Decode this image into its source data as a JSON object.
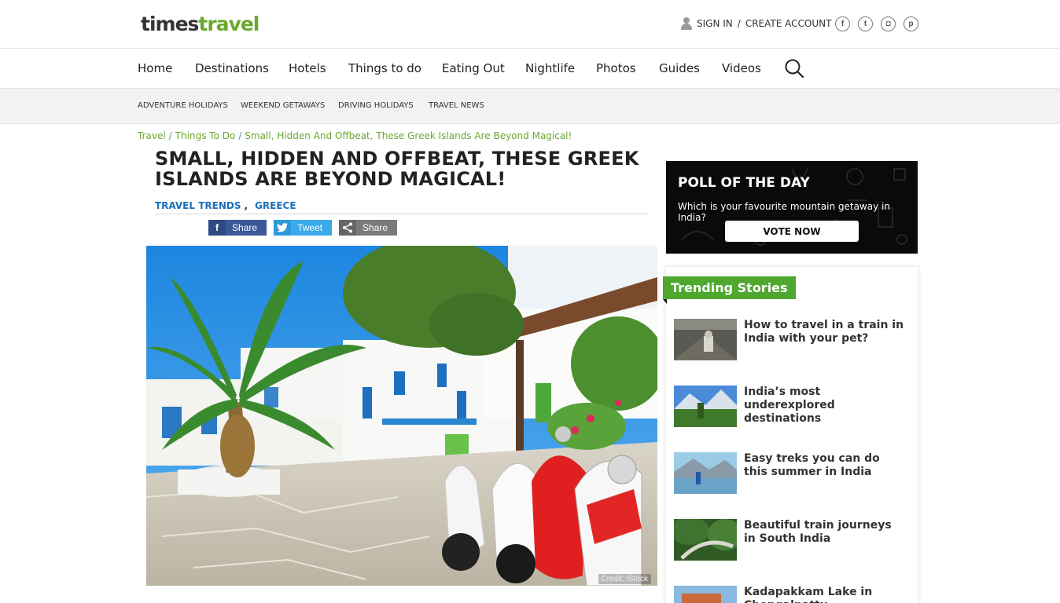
{
  "header": {
    "logo_part1": "times",
    "logo_part2": "travel",
    "sign_in": "SIGN IN",
    "separator": "/",
    "create_account": "CREATE ACCOUNT",
    "socials": [
      {
        "icon": "facebook-icon",
        "glyph": "f"
      },
      {
        "icon": "twitter-icon",
        "glyph": "t"
      },
      {
        "icon": "instagram-icon",
        "glyph": "◘"
      },
      {
        "icon": "pinterest-icon",
        "glyph": "p"
      }
    ]
  },
  "main_nav": [
    "Home",
    "Destinations",
    "Hotels",
    "Things to do",
    "Eating Out",
    "Nightlife",
    "Photos",
    "Guides",
    "Videos"
  ],
  "sub_nav": [
    "ADVENTURE HOLIDAYS",
    "WEEKEND GETAWAYS",
    "DRIVING HOLIDAYS",
    "TRAVEL NEWS"
  ],
  "breadcrumb": [
    "Travel",
    "Things To Do",
    "Small, Hidden And Offbeat, These Greek Islands Are Beyond Magical!"
  ],
  "article": {
    "title": "SMALL, HIDDEN AND OFFBEAT, THESE GREEK ISLANDS ARE BEYOND MAGICAL!",
    "tags": [
      "TRAVEL TRENDS",
      "GREECE"
    ],
    "tag_separator": ",",
    "share": {
      "facebook": "Share",
      "twitter": "Tweet",
      "generic": "Share"
    },
    "image_credit": "Credit: iStock"
  },
  "poll": {
    "title": "POLL OF THE DAY",
    "question": "Which is your favourite mountain getaway in India?",
    "button": "VOTE NOW"
  },
  "trending": {
    "heading": "Trending Stories",
    "stories": [
      {
        "title": "How to travel in a train in India with your pet?"
      },
      {
        "title": "India’s most underexplored destinations"
      },
      {
        "title": "Easy treks you can do this summer in India"
      },
      {
        "title": "Beautiful train journeys in South India"
      },
      {
        "title": "Kadapakkam Lake in Chengalpattu"
      }
    ]
  },
  "colors": {
    "brand_green": "#6aa82e",
    "tag_blue": "#1b6fb8",
    "facebook": "#3b5998",
    "twitter": "#3aa9e8"
  }
}
